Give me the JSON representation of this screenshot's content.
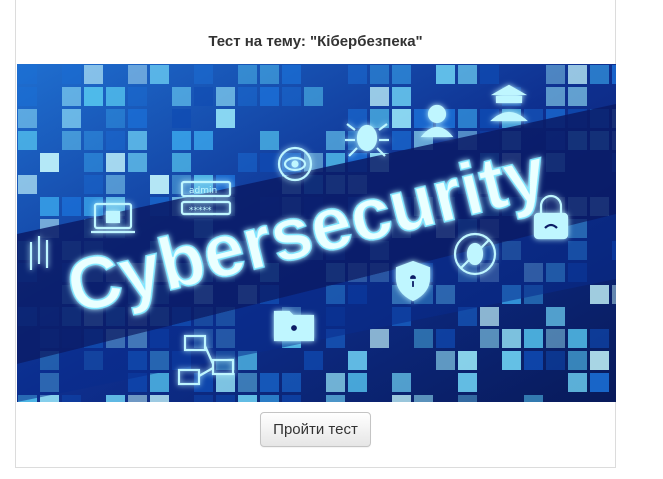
{
  "test": {
    "title": "Тест на тему: \"Кібербезпека\"",
    "button_label": "Пройти тест"
  },
  "hero": {
    "headline": "Cybersecurity",
    "admin_label": "admin",
    "password_mask": "*****",
    "icons": [
      "monitor-lock-icon",
      "admin-login-icon",
      "eye-target-icon",
      "bug-icon",
      "hacker-icon",
      "user-network-icon",
      "shield-keyhole-icon",
      "no-bug-icon",
      "padlock-wifi-icon",
      "folder-lock-icon",
      "network-computers-icon"
    ]
  },
  "colors": {
    "accent_glow": "#7fe6ff",
    "deep_blue": "#0a1a5c",
    "tile_light": "#9ef0ff"
  }
}
